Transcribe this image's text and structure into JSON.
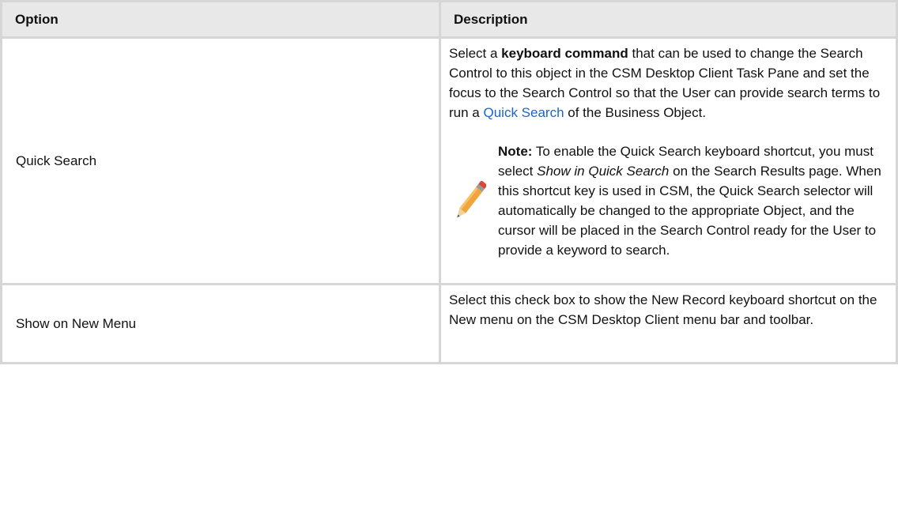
{
  "table": {
    "headers": {
      "option": "Option",
      "description": "Description"
    },
    "rows": [
      {
        "option": "Quick Search",
        "desc": {
          "p1_before": "Select a ",
          "p1_bold": "keyboard command",
          "p1_mid": " that can be used to change the Search Control to this object in the CSM Desktop Client Task Pane and set the focus to the Search Control so that the User can provide search terms to run a ",
          "p1_link": "Quick Search",
          "p1_after": " of the Business Object."
        },
        "note": {
          "icon": "pencil-icon",
          "label": "Note:",
          "t1": " To enable the Quick Search keyboard shortcut, you must select ",
          "italic": "Show in Quick Search",
          "t2": " on the Search Results page. When this shortcut key is used in CSM, the Quick Search selector will automatically be changed to the appropriate Object, and the cursor will be placed in the Search Control ready for the User to provide a keyword to search."
        }
      },
      {
        "option": "Show on New Menu",
        "desc_text": "Select this check box to show the New Record keyboard shortcut on the New menu on the CSM Desktop Client menu bar and toolbar."
      }
    ]
  },
  "colors": {
    "link": "#1a63d8",
    "header_bg": "#e8e8e8",
    "border": "#d6d6d6"
  }
}
